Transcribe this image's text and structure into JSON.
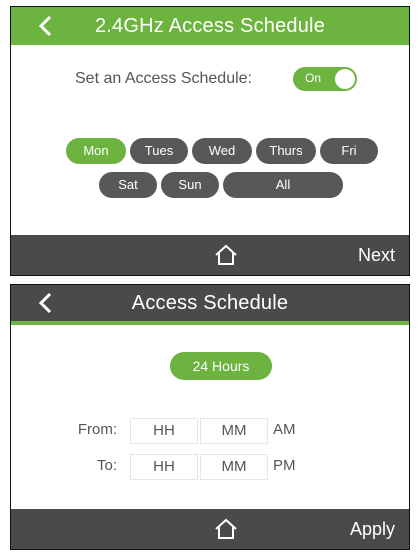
{
  "screen1": {
    "title": "2.4GHz Access Schedule",
    "schedule_label": "Set an Access Schedule:",
    "toggle_label": "On",
    "days_row1": [
      "Mon",
      "Tues",
      "Wed",
      "Thurs",
      "Fri"
    ],
    "days_row2": [
      "Sat",
      "Sun",
      "All"
    ],
    "selected_day": "Mon",
    "next_label": "Next"
  },
  "screen2": {
    "title": "Access Schedule",
    "hours_button": "24 Hours",
    "from_label": "From:",
    "to_label": "To:",
    "from_hh": "HH",
    "from_mm": "MM",
    "from_ampm": "AM",
    "to_hh": "HH",
    "to_mm": "MM",
    "to_ampm": "PM",
    "apply_label": "Apply"
  },
  "icons": {
    "back": "chevron-left-icon",
    "home": "home-icon"
  },
  "colors": {
    "accent_green": "#6db33f",
    "bar_gray": "#4a4a4a",
    "pill_gray": "#585858",
    "text_gray": "#555555"
  }
}
